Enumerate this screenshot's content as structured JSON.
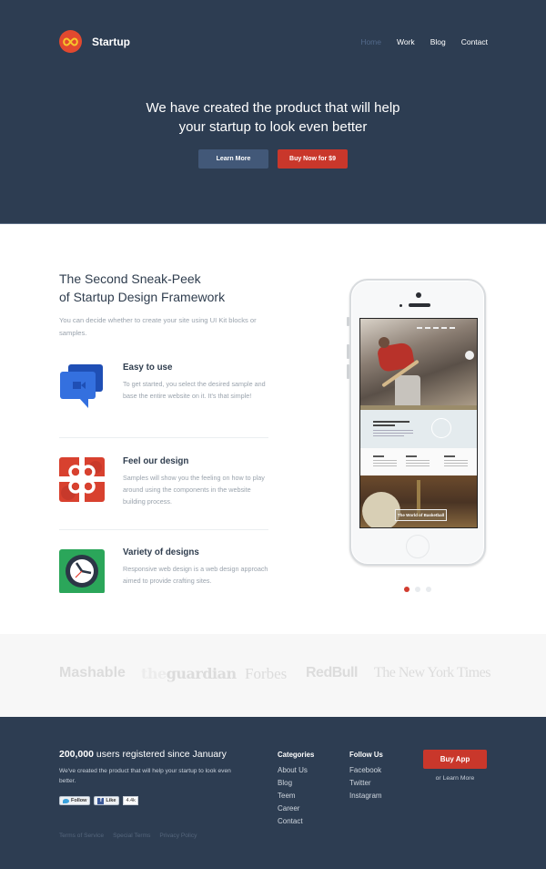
{
  "header": {
    "brand": "Startup",
    "nav": [
      {
        "label": "Home",
        "active": true
      },
      {
        "label": "Work",
        "active": false
      },
      {
        "label": "Blog",
        "active": false
      },
      {
        "label": "Contact",
        "active": false
      }
    ],
    "hero_line1": "We have created the product that will help",
    "hero_line2": "your startup to look even better",
    "learn_more_label": "Learn More",
    "buy_now_label": "Buy Now for $9"
  },
  "features": {
    "title_line1": "The Second Sneak-Peek",
    "title_line2": "of Startup Design Framework",
    "intro": "You can decide whether to create your site using UI Kit blocks or samples.",
    "items": [
      {
        "icon": "chat-video-icon",
        "title": "Easy to use",
        "text": "To get started, you select the desired sample and base the entire website on it. It's that simple!"
      },
      {
        "icon": "gift-icon",
        "title": "Feel our design",
        "text": "Samples will show you the feeling on how to play around using the components in the website building process."
      },
      {
        "icon": "clock-icon",
        "title": "Variety of designs",
        "text": "Responsive web design is a web design approach aimed to provide crafting sites."
      }
    ]
  },
  "phone": {
    "screen_caption": "The World of Basketball",
    "carousel": {
      "total": 3,
      "active_index": 0
    }
  },
  "press_logos": [
    "Mashable",
    "the",
    "guardian",
    "Forbes",
    "RedBull",
    "The New York Times"
  ],
  "footer": {
    "headline_bold": "200,000",
    "headline_rest": " users registered since January",
    "text": "We've created the product that will help your startup to look even better.",
    "twitter_label": "Follow",
    "facebook_label": "Like",
    "facebook_count": "4.4k",
    "categories_title": "Categories",
    "categories": [
      "About Us",
      "Blog",
      "Teem",
      "Career",
      "Contact"
    ],
    "follow_title": "Follow Us",
    "follow": [
      "Facebook",
      "Twitter",
      "Instagram"
    ],
    "buy_app_label": "Buy App",
    "or_learn_more": "or Learn More",
    "legal_links": [
      "Terms of Service",
      "Special Terms",
      "Privacy Policy"
    ]
  },
  "colors": {
    "navy": "#2d3d52",
    "accent_red": "#c9372b",
    "button_blue": "#425878",
    "logo_band": "#f7f7f7"
  }
}
